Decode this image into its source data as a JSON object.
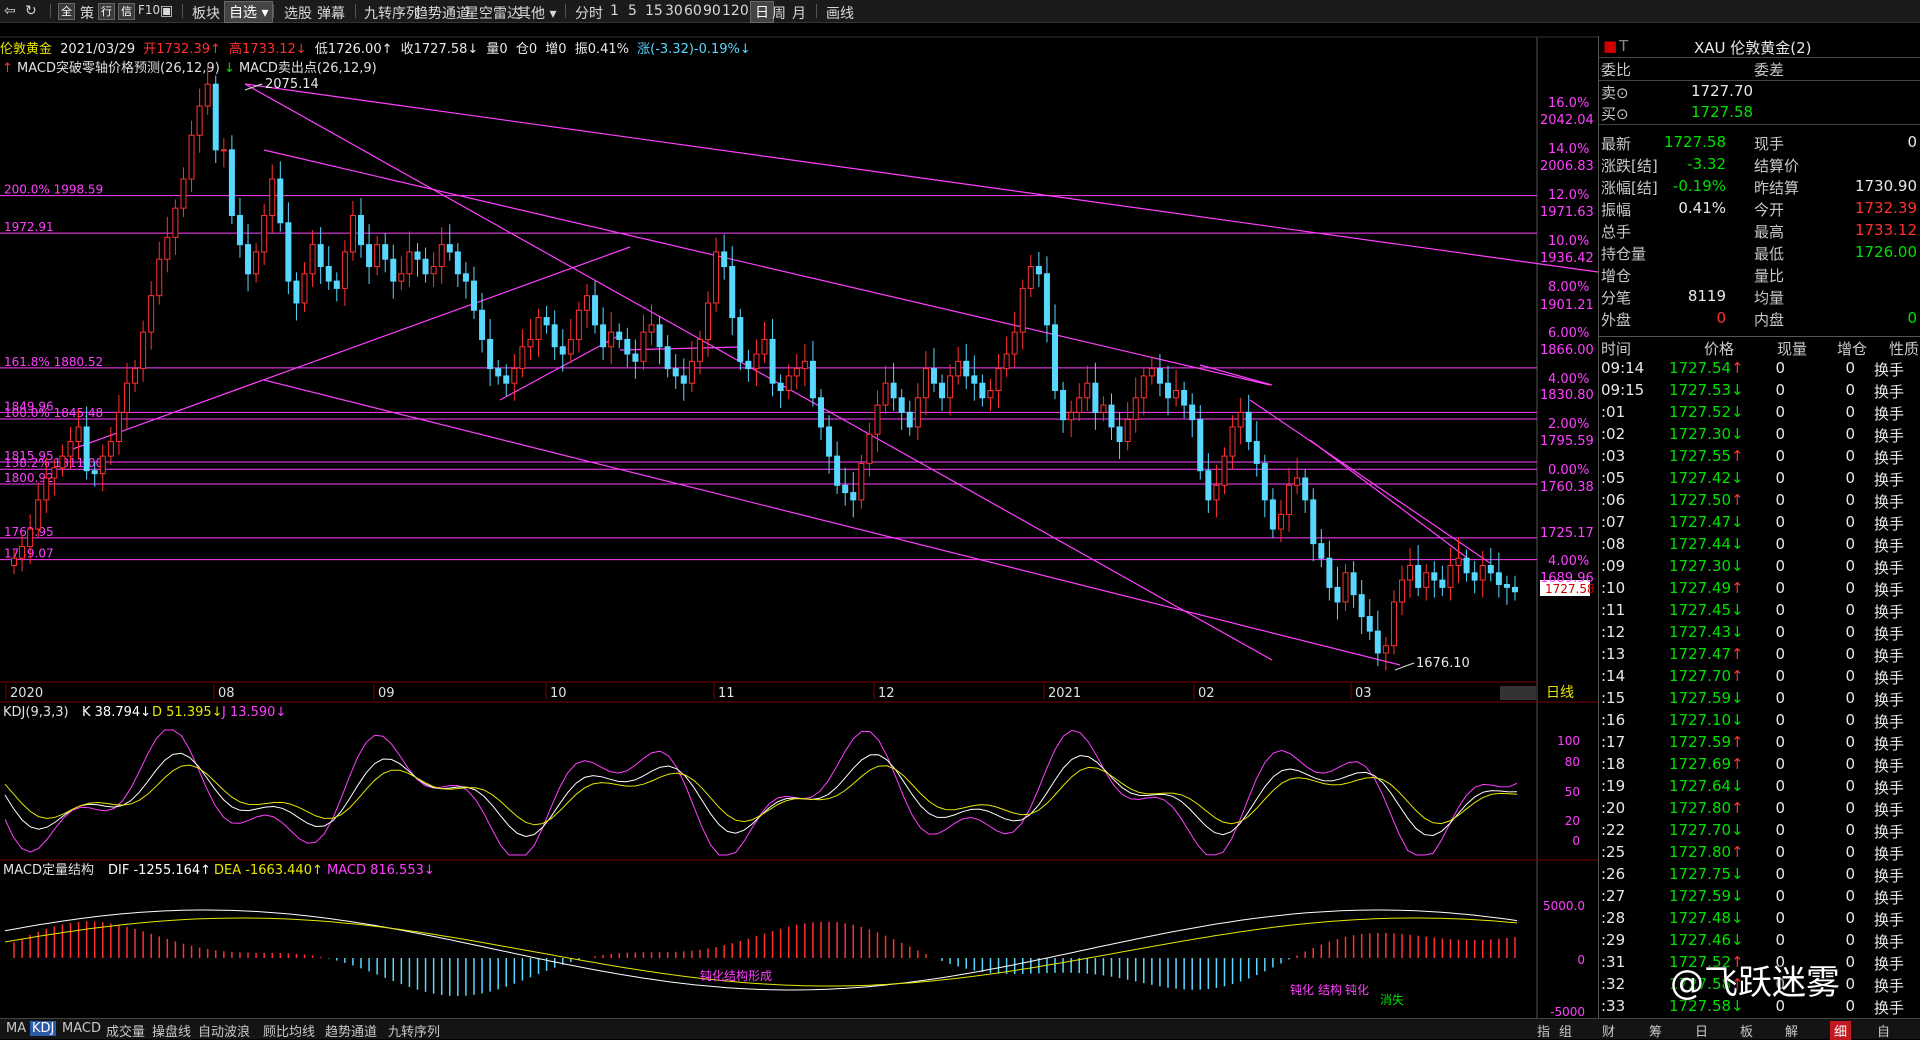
{
  "toolbar": {
    "items": [
      "全",
      "策",
      "行",
      "信",
      "F10",
      "板块",
      "自选",
      "选股",
      "弹幕",
      "九转序列",
      "趋势通道",
      "星空雷达",
      "其他",
      "分时",
      "1",
      "5",
      "15",
      "30",
      "60",
      "90",
      "120",
      "日",
      "周",
      "月",
      "画线"
    ]
  },
  "header": {
    "name": "伦敦黄金",
    "date": "2021/03/29",
    "open": "开1732.39↑",
    "high": "高1733.12↓",
    "low": "低1726.00↑",
    "close": "收1727.58↓",
    "vol": "量0",
    "oi": "仓0",
    "inc": "增0",
    "amp": "振0.41%",
    "chg": "涨(-3.32)-0.19%↓",
    "ind1": "MACD突破零轴价格预测(26,12,9)",
    "ind2": "MACD卖出点(26,12,9)"
  },
  "chart_data": [
    {
      "type": "candlestick",
      "title": "伦敦黄金 日线",
      "x_labels": [
        "2020",
        "08",
        "09",
        "10",
        "11",
        "12",
        "2021",
        "02",
        "03"
      ],
      "ylim": [
        1676.1,
        2075.14
      ],
      "annotations": {
        "high": "2075.14",
        "low": "1676.10",
        "last": "1727.58",
        "fib_levels": [
          {
            "label": "200.0% 1998.59",
            "value": 1998.59
          },
          {
            "label": "1972.91",
            "value": 1972.91
          },
          {
            "label": "161.8% 1880.52",
            "value": 1880.52
          },
          {
            "label": "1849.96",
            "value": 1849.96
          },
          {
            "label": "100.0% 1845.48",
            "value": 1845.48
          },
          {
            "label": "1815.95",
            "value": 1815.95
          },
          {
            "label": "138.2% 1811.00",
            "value": 1811.0
          },
          {
            "label": "1800.92",
            "value": 1800.92
          },
          {
            "label": "1763.95",
            "value": 1763.95
          },
          {
            "label": "1749.07",
            "value": 1749.07
          }
        ]
      },
      "right_axis": [
        {
          "pct": "16.0%",
          "price": "2042.04"
        },
        {
          "pct": "14.0%",
          "price": "2006.83"
        },
        {
          "pct": "12.0%",
          "price": "1971.63"
        },
        {
          "pct": "10.0%",
          "price": "1936.42"
        },
        {
          "pct": "8.00%",
          "price": "1901.21"
        },
        {
          "pct": "6.00%",
          "price": "1866.00"
        },
        {
          "pct": "4.00%",
          "price": "1830.80"
        },
        {
          "pct": "2.00%",
          "price": "1795.59"
        },
        {
          "pct": "0.00%",
          "price": "1760.38"
        },
        {
          "pct": "",
          "price": "1725.17"
        },
        {
          "pct": "4.00%",
          "price": "1689.96"
        }
      ],
      "period_label": "日线"
    },
    {
      "type": "line",
      "title": "KDJ(9,3,3)",
      "series": [
        {
          "name": "K",
          "value": "K 38.794↓"
        },
        {
          "name": "D",
          "value": "D 51.395↓"
        },
        {
          "name": "J",
          "value": "J 13.590↓"
        }
      ],
      "y_ticks": [
        "100",
        "80",
        "50",
        "20",
        "0"
      ]
    },
    {
      "type": "bar",
      "title": "MACD定量结构",
      "series": [
        {
          "name": "DIF",
          "value": "DIF -1255.164↑"
        },
        {
          "name": "DEA",
          "value": "DEA -1663.440↑"
        },
        {
          "name": "MACD",
          "value": "MACD 816.553↓"
        }
      ],
      "y_ticks": [
        "5000.0",
        "0",
        "-5000"
      ],
      "annotations": [
        "钝化结构形成",
        "钝化",
        "结构",
        "钝化",
        "消失"
      ]
    }
  ],
  "panel": {
    "title": "XAU 伦敦黄金(2)",
    "weibi_label": "委比",
    "weicha_label": "委差",
    "sell_label": "卖⊙",
    "sell": "1727.70",
    "buy_label": "买⊙",
    "buy": "1727.58",
    "rows": [
      {
        "l1": "最新",
        "v1": "1727.58",
        "l2": "现手",
        "v2": "0"
      },
      {
        "l1": "涨跌[结]",
        "v1": "-3.32",
        "l2": "结算价",
        "v2": ""
      },
      {
        "l1": "涨幅[结]",
        "v1": "-0.19%",
        "l2": "昨结算",
        "v2": "1730.90"
      },
      {
        "l1": "振幅",
        "v1": "0.41%",
        "l2": "今开",
        "v2": "1732.39"
      },
      {
        "l1": "总手",
        "v1": "",
        "l2": "最高",
        "v2": "1733.12"
      },
      {
        "l1": "持仓量",
        "v1": "",
        "l2": "最低",
        "v2": "1726.00"
      },
      {
        "l1": "增仓",
        "v1": "",
        "l2": "量比",
        "v2": ""
      },
      {
        "l1": "分笔",
        "v1": "8119",
        "l2": "均量",
        "v2": ""
      },
      {
        "l1": "外盘",
        "v1": "0",
        "l2": "内盘",
        "v2": "0"
      }
    ],
    "tick_headers": [
      "时间",
      "价格",
      "现量",
      "增仓",
      "性质"
    ],
    "ticks": [
      {
        "t": "09:14",
        "p": "1727.54↑",
        "q": "0",
        "z": "0",
        "x": "换手"
      },
      {
        "t": "09:15",
        "p": "1727.53↓",
        "q": "0",
        "z": "0",
        "x": "换手"
      },
      {
        "t": ":01",
        "p": "1727.52↓",
        "q": "0",
        "z": "0",
        "x": "换手"
      },
      {
        "t": ":02",
        "p": "1727.30↓",
        "q": "0",
        "z": "0",
        "x": "换手"
      },
      {
        "t": ":03",
        "p": "1727.55↑",
        "q": "0",
        "z": "0",
        "x": "换手"
      },
      {
        "t": ":05",
        "p": "1727.42↓",
        "q": "0",
        "z": "0",
        "x": "换手"
      },
      {
        "t": ":06",
        "p": "1727.50↑",
        "q": "0",
        "z": "0",
        "x": "换手"
      },
      {
        "t": ":07",
        "p": "1727.47↓",
        "q": "0",
        "z": "0",
        "x": "换手"
      },
      {
        "t": ":08",
        "p": "1727.44↓",
        "q": "0",
        "z": "0",
        "x": "换手"
      },
      {
        "t": ":09",
        "p": "1727.30↓",
        "q": "0",
        "z": "0",
        "x": "换手"
      },
      {
        "t": ":10",
        "p": "1727.49↑",
        "q": "0",
        "z": "0",
        "x": "换手"
      },
      {
        "t": ":11",
        "p": "1727.45↓",
        "q": "0",
        "z": "0",
        "x": "换手"
      },
      {
        "t": ":12",
        "p": "1727.43↓",
        "q": "0",
        "z": "0",
        "x": "换手"
      },
      {
        "t": ":13",
        "p": "1727.47↑",
        "q": "0",
        "z": "0",
        "x": "换手"
      },
      {
        "t": ":14",
        "p": "1727.70↑",
        "q": "0",
        "z": "0",
        "x": "换手"
      },
      {
        "t": ":15",
        "p": "1727.59↓",
        "q": "0",
        "z": "0",
        "x": "换手"
      },
      {
        "t": ":16",
        "p": "1727.10↓",
        "q": "0",
        "z": "0",
        "x": "换手"
      },
      {
        "t": ":17",
        "p": "1727.59↑",
        "q": "0",
        "z": "0",
        "x": "换手"
      },
      {
        "t": ":18",
        "p": "1727.69↑",
        "q": "0",
        "z": "0",
        "x": "换手"
      },
      {
        "t": ":19",
        "p": "1727.64↓",
        "q": "0",
        "z": "0",
        "x": "换手"
      },
      {
        "t": ":20",
        "p": "1727.80↑",
        "q": "0",
        "z": "0",
        "x": "换手"
      },
      {
        "t": ":22",
        "p": "1727.70↓",
        "q": "0",
        "z": "0",
        "x": "换手"
      },
      {
        "t": ":25",
        "p": "1727.80↑",
        "q": "0",
        "z": "0",
        "x": "换手"
      },
      {
        "t": ":26",
        "p": "1727.75↓",
        "q": "0",
        "z": "0",
        "x": "换手"
      },
      {
        "t": ":27",
        "p": "1727.59↓",
        "q": "0",
        "z": "0",
        "x": "换手"
      },
      {
        "t": ":28",
        "p": "1727.48↓",
        "q": "0",
        "z": "0",
        "x": "换手"
      },
      {
        "t": ":29",
        "p": "1727.46↓",
        "q": "0",
        "z": "0",
        "x": "换手"
      },
      {
        "t": ":31",
        "p": "1727.52↑",
        "q": "0",
        "z": "0",
        "x": "换手"
      },
      {
        "t": ":32",
        "p": "1727.58↑",
        "q": "0",
        "z": "0",
        "x": "换手"
      },
      {
        "t": ":33",
        "p": "1727.58↓",
        "q": "0",
        "z": "0",
        "x": "换手"
      }
    ]
  },
  "bottom_tabs": [
    "MA",
    "KDJ",
    "MACD",
    "成交量",
    "操盘线",
    "自动波浪",
    "顾比均线",
    "趋势通道",
    "九转序列"
  ],
  "right_tabs": [
    "指",
    "组",
    "财",
    "筹",
    "日",
    "板",
    "解",
    "细",
    "自"
  ],
  "watermark": "@飞跃迷雾",
  "colors": {
    "bg": "#000000",
    "up": "#ff3030",
    "down": "#58d7ff",
    "fib": "#ff40ff",
    "k": "#ffffff",
    "d": "#e6e600",
    "j": "#ff40ff"
  }
}
